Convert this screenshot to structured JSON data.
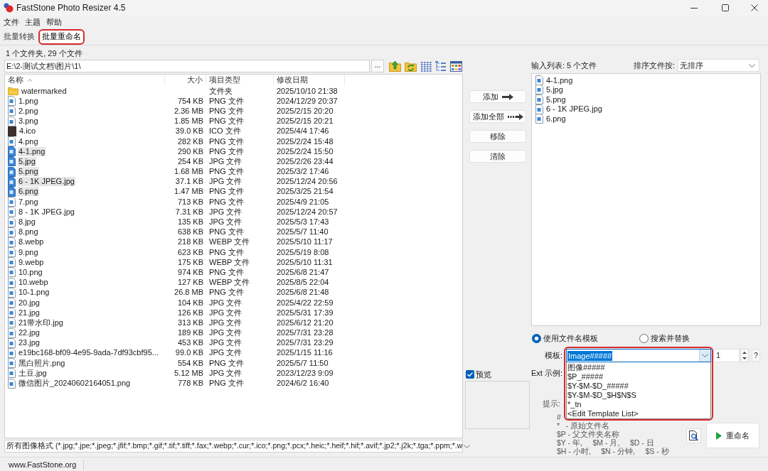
{
  "window": {
    "title": "FastStone Photo Resizer 4.5"
  },
  "menu": [
    "文件",
    "主题",
    "帮助"
  ],
  "tabs": [
    {
      "label": "批量转换",
      "selected": false,
      "highlighted": false
    },
    {
      "label": "批量重命名",
      "selected": true,
      "highlighted": true
    }
  ],
  "summary": "1 个文件夹, 29 个文件",
  "path_bar": {
    "value": "E:\\2-测试文档\\图片\\1\\",
    "browse": "..."
  },
  "file_list": {
    "columns": [
      {
        "label": "名称",
        "sorted": true
      },
      {
        "label": "大小",
        "sorted": false
      },
      {
        "label": "项目类型",
        "sorted": false
      },
      {
        "label": "修改日期",
        "sorted": false
      }
    ],
    "rows": [
      {
        "name": "watermarked",
        "type": "文件夹",
        "date": "2025/10/10 21:38",
        "kind": "folder",
        "selected": false
      },
      {
        "name": "1.png",
        "size": "754 KB",
        "type": "PNG 文件",
        "date": "2024/12/29 20:37",
        "kind": "file",
        "selected": false
      },
      {
        "name": "2.png",
        "size": "2.36 MB",
        "type": "PNG 文件",
        "date": "2025/2/15 20:20",
        "kind": "file",
        "selected": false
      },
      {
        "name": "3.png",
        "size": "1.85 MB",
        "type": "PNG 文件",
        "date": "2025/2/15 20:21",
        "kind": "file",
        "selected": false
      },
      {
        "name": "4.ico",
        "size": "39.0 KB",
        "type": "ICO 文件",
        "date": "2025/4/4 17:46",
        "kind": "thumbnail",
        "selected": false
      },
      {
        "name": "4.png",
        "size": "282 KB",
        "type": "PNG 文件",
        "date": "2025/2/24 15:48",
        "kind": "file",
        "selected": false
      },
      {
        "name": "4-1.png",
        "size": "290 KB",
        "type": "PNG 文件",
        "date": "2025/2/24 15:50",
        "kind": "file",
        "selected": true
      },
      {
        "name": "5.jpg",
        "size": "254 KB",
        "type": "JPG 文件",
        "date": "2025/2/26 23:44",
        "kind": "file",
        "selected": true
      },
      {
        "name": "5.png",
        "size": "1.68 MB",
        "type": "PNG 文件",
        "date": "2025/3/2 17:46",
        "kind": "file",
        "selected": true
      },
      {
        "name": "6 - 1K JPEG.jpg",
        "size": "37.1 KB",
        "type": "JPG 文件",
        "date": "2025/12/24 20:56",
        "kind": "file",
        "selected": true
      },
      {
        "name": "6.png",
        "size": "1.47 MB",
        "type": "PNG 文件",
        "date": "2025/3/25 21:54",
        "kind": "file",
        "selected": true
      },
      {
        "name": "7.png",
        "size": "713 KB",
        "type": "PNG 文件",
        "date": "2025/4/9 21:05",
        "kind": "file",
        "selected": false
      },
      {
        "name": "8 - 1K JPEG.jpg",
        "size": "7.31 KB",
        "type": "JPG 文件",
        "date": "2025/12/24 20:57",
        "kind": "file",
        "selected": false
      },
      {
        "name": "8.jpg",
        "size": "135 KB",
        "type": "JPG 文件",
        "date": "2025/5/3 17:43",
        "kind": "file",
        "selected": false
      },
      {
        "name": "8.png",
        "size": "638 KB",
        "type": "PNG 文件",
        "date": "2025/5/7 11:40",
        "kind": "file",
        "selected": false
      },
      {
        "name": "8.webp",
        "size": "218 KB",
        "type": "WEBP 文件",
        "date": "2025/5/10 11:17",
        "kind": "file",
        "selected": false
      },
      {
        "name": "9.png",
        "size": "623 KB",
        "type": "PNG 文件",
        "date": "2025/5/19 8:08",
        "kind": "file",
        "selected": false
      },
      {
        "name": "9.webp",
        "size": "175 KB",
        "type": "WEBP 文件",
        "date": "2025/5/10 11:31",
        "kind": "file",
        "selected": false
      },
      {
        "name": "10.png",
        "size": "974 KB",
        "type": "PNG 文件",
        "date": "2025/6/8 21:47",
        "kind": "file",
        "selected": false
      },
      {
        "name": "10.webp",
        "size": "127 KB",
        "type": "WEBP 文件",
        "date": "2025/8/5 22:04",
        "kind": "file",
        "selected": false
      },
      {
        "name": "10-1.png",
        "size": "26.8 MB",
        "type": "PNG 文件",
        "date": "2025/6/8 21:48",
        "kind": "file",
        "selected": false
      },
      {
        "name": "20.jpg",
        "size": "104 KB",
        "type": "JPG 文件",
        "date": "2025/4/22 22:59",
        "kind": "file",
        "selected": false
      },
      {
        "name": "21.jpg",
        "size": "126 KB",
        "type": "JPG 文件",
        "date": "2025/5/31 17:39",
        "kind": "file",
        "selected": false
      },
      {
        "name": "21带水印.jpg",
        "size": "313 KB",
        "type": "JPG 文件",
        "date": "2025/6/12 21:20",
        "kind": "file",
        "selected": false
      },
      {
        "name": "22.jpg",
        "size": "189 KB",
        "type": "JPG 文件",
        "date": "2025/7/31 23:28",
        "kind": "file",
        "selected": false
      },
      {
        "name": "23.jpg",
        "size": "453 KB",
        "type": "JPG 文件",
        "date": "2025/7/31 23:29",
        "kind": "file",
        "selected": false
      },
      {
        "name": "e19bc168-bf09-4e95-9ada-7df93cbf95...",
        "size": "99.0 KB",
        "type": "JPG 文件",
        "date": "2025/1/15 11:16",
        "kind": "file",
        "selected": false
      },
      {
        "name": "黑白照片.png",
        "size": "554 KB",
        "type": "PNG 文件",
        "date": "2025/5/7 11:50",
        "kind": "file",
        "selected": false
      },
      {
        "name": "土豆.jpg",
        "size": "5.12 MB",
        "type": "JPG 文件",
        "date": "2023/12/23 9:09",
        "kind": "file",
        "selected": false
      },
      {
        "name": "微信图片_20240602164051.png",
        "size": "778 KB",
        "type": "PNG 文件",
        "date": "2024/6/2 16:40",
        "kind": "file",
        "selected": false
      }
    ]
  },
  "filter": {
    "value": "所有图像格式 (*.jpg;*.jpe;*.jpeg;*.jfif;*.bmp;*.gif;*.tif;*.tiff;*.fax;*.webp;*.cur;*.ico;*.png;*.pcx;*.heic;*.heif;*.hif;*.avif;*.jp2;*.j2k;*.tga;*.ppm;*.w"
  },
  "actions": [
    {
      "label": "添加",
      "kind": "arrow"
    },
    {
      "label": "添加全部",
      "kind": "dashed-arrow"
    },
    {
      "label": "移除",
      "kind": "plain"
    },
    {
      "label": "清除",
      "kind": "plain"
    }
  ],
  "preview": {
    "label": "预览",
    "checked": true
  },
  "input_list": {
    "label": "输入列表: 5 个文件",
    "sort_label": "排序文件按:",
    "sort_value": "无排序",
    "files": [
      "4-1.png",
      "5.jpg",
      "5.png",
      "6 - 1K JPEG.jpg",
      "6.png"
    ]
  },
  "rename": {
    "modes": [
      {
        "label": "使用文件名模板",
        "selected": true
      },
      {
        "label": "搜索并替换",
        "selected": false
      }
    ],
    "template": {
      "label": "模板:",
      "value": "Image#####",
      "value_selected": true,
      "expanded": true,
      "highlighted": true,
      "options": [
        "图像#####",
        "$P_#####",
        "$Y-$M-$D_#####",
        "$Y-$M-$D_$H$N$S",
        "*_tn",
        "<Edit Template List>"
      ]
    },
    "start_number": "1",
    "help": "?",
    "ext_label": "Ext 示例:",
    "hint_label": "提示:",
    "hints": [
      "#",
      "*   - 原始文件名",
      "$P - 父文件夹名称",
      "$Y - 年,     $M - 月,     $D - 日",
      "$H - 小时,     $N - 分钟,     $S - 秒"
    ],
    "rename_button": "重命名"
  },
  "status_bar": {
    "text": "www.FastStone.org"
  }
}
